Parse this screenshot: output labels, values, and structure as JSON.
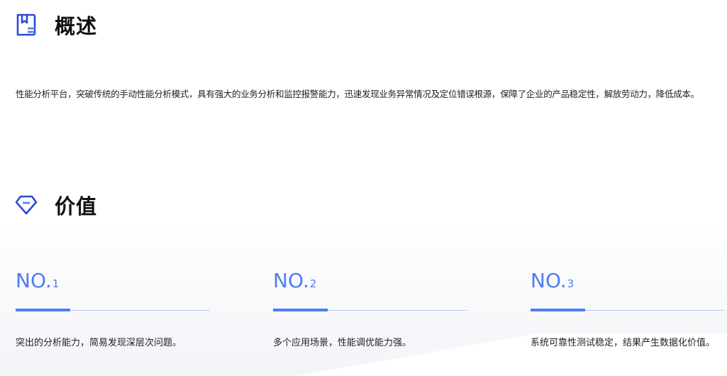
{
  "overview": {
    "title": "概述",
    "icon": "bookmark-book-icon",
    "text": "性能分析平台，突破传统的手动性能分析模式，具有强大的业务分析和监控报警能力，迅速发现业务异常情况及定位错误根源，保障了企业的产品稳定性，解放劳动力，降低成本。"
  },
  "value": {
    "title": "价值",
    "icon": "diamond-icon",
    "cards": [
      {
        "prefix": "NO.",
        "number": "1",
        "text": "突出的分析能力，简易发现深层次问题。"
      },
      {
        "prefix": "NO.",
        "number": "2",
        "text": "多个应用场景，性能调优能力强。"
      },
      {
        "prefix": "NO.",
        "number": "3",
        "text": "系统可靠性测试稳定，结果产生数据化价值。"
      }
    ]
  },
  "colors": {
    "accent": "#4f7df0",
    "accent_light": "#bcccf5",
    "icon_blue": "#2f4bd6"
  }
}
